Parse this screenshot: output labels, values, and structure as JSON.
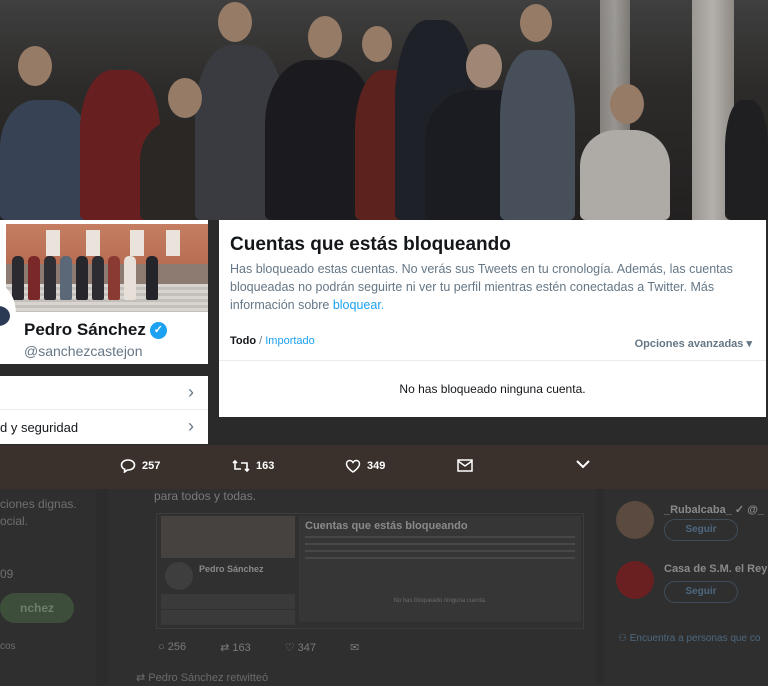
{
  "panel": {
    "title": "Cuentas que estás bloqueando",
    "description": "Has bloqueado estas cuentas. No verás sus Tweets en tu cronología. Además, las cuentas bloqueadas no podrán seguirte ni ver tu perfil mientras estén conectadas a Twitter. Más información sobre ",
    "learn_more_link": "bloquear.",
    "filter_all": "Todo",
    "filter_separator": "/",
    "filter_imported": "Importado",
    "advanced_options": "Opciones avanzadas",
    "empty_message": "No has bloqueado ninguna cuenta."
  },
  "profile": {
    "name": "Pedro Sánchez",
    "handle": "@sanchezcastejon",
    "verified_icon": "verified-badge-icon"
  },
  "menu": {
    "items": [
      {
        "label": ""
      },
      {
        "label": "d y seguridad"
      }
    ]
  },
  "actions": {
    "replies": "257",
    "retweets": "163",
    "likes": "349"
  },
  "underlay": {
    "tweet_text": "para todos y todas.",
    "left_line1": "ciones dignas.",
    "left_line2": "ocial.",
    "left_date": "09",
    "left_follow": "nchez",
    "left_other": "cos",
    "embed_title": "Cuentas que estás bloqueando",
    "embed_empty": "No has bloqueado ninguna cuenta.",
    "embed_name": "Pedro Sánchez",
    "stats_replies": "256",
    "stats_retweets": "163",
    "stats_likes": "347",
    "retweeted_by": "Pedro Sánchez retwitteó",
    "suggest1_name": "_Rubalcaba_ ✓ @_",
    "suggest1_btn": "Seguir",
    "suggest2_name": "Casa de S.M. el Rey",
    "suggest2_btn": "Seguir",
    "find_people": "Encuentra a personas que co"
  },
  "colors": {
    "accent": "#1da1f2",
    "action_bar": "#3a302c"
  }
}
